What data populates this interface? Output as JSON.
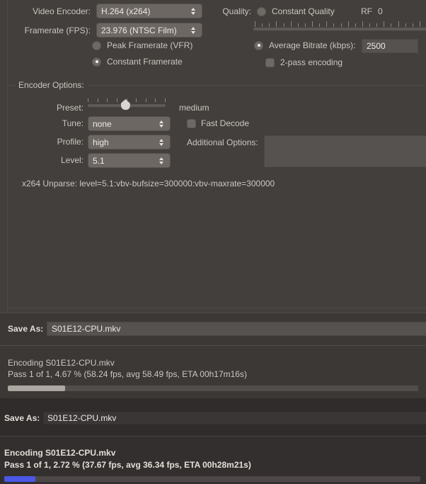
{
  "encoder": {
    "video_encoder_label": "Video Encoder:",
    "video_encoder_value": "H.264 (x264)",
    "framerate_label": "Framerate (FPS):",
    "framerate_value": "23.976 (NTSC Film)",
    "peak_framerate_label": "Peak Framerate (VFR)",
    "constant_framerate_label": "Constant Framerate",
    "framerate_mode": "constant"
  },
  "quality": {
    "quality_label": "Quality:",
    "constant_quality_label": "Constant Quality",
    "rf_label": "RF",
    "rf_value": "0",
    "avg_bitrate_label": "Average Bitrate (kbps):",
    "avg_bitrate_value": "2500",
    "two_pass_label": "2-pass encoding",
    "two_pass_checked": false,
    "rate_mode": "average_bitrate"
  },
  "encoder_options": {
    "group_label": "Encoder Options:",
    "preset_label": "Preset:",
    "preset_value": "medium",
    "preset_position_pct": 48,
    "preset_tick_count": 9,
    "tune_label": "Tune:",
    "tune_value": "none",
    "fast_decode_label": "Fast Decode",
    "fast_decode_checked": false,
    "profile_label": "Profile:",
    "profile_value": "high",
    "additional_options_label": "Additional Options:",
    "additional_options_value": "",
    "level_label": "Level:",
    "level_value": "5.1",
    "unparse_text": "x264 Unparse: level=5.1:vbv-bufsize=300000:vbv-maxrate=300000"
  },
  "save_bar_top": {
    "label": "Save As:",
    "value": "S01E12-CPU.mkv"
  },
  "status_top": {
    "line1": "Encoding S01E12-CPU.mkv",
    "line2": "Pass 1 of 1, 4.67 % (58.24 fps, avg 58.49 fps, ETA 00h17m16s)",
    "progress_pct": 4.67,
    "progress_bar_fill_pct": 14,
    "progress_color": "#aca7a1"
  },
  "save_bar_bottom": {
    "label": "Save As:",
    "value": "S01E12-CPU.mkv"
  },
  "status_bottom": {
    "line1": "Encoding S01E12-CPU.mkv",
    "line2": "Pass 1 of 1, 2.72 % (37.67 fps, avg 36.34 fps, ETA 00h28m21s)",
    "progress_pct": 2.72,
    "progress_bar_fill_pct": 7.5,
    "progress_color": "#4a57e8"
  }
}
